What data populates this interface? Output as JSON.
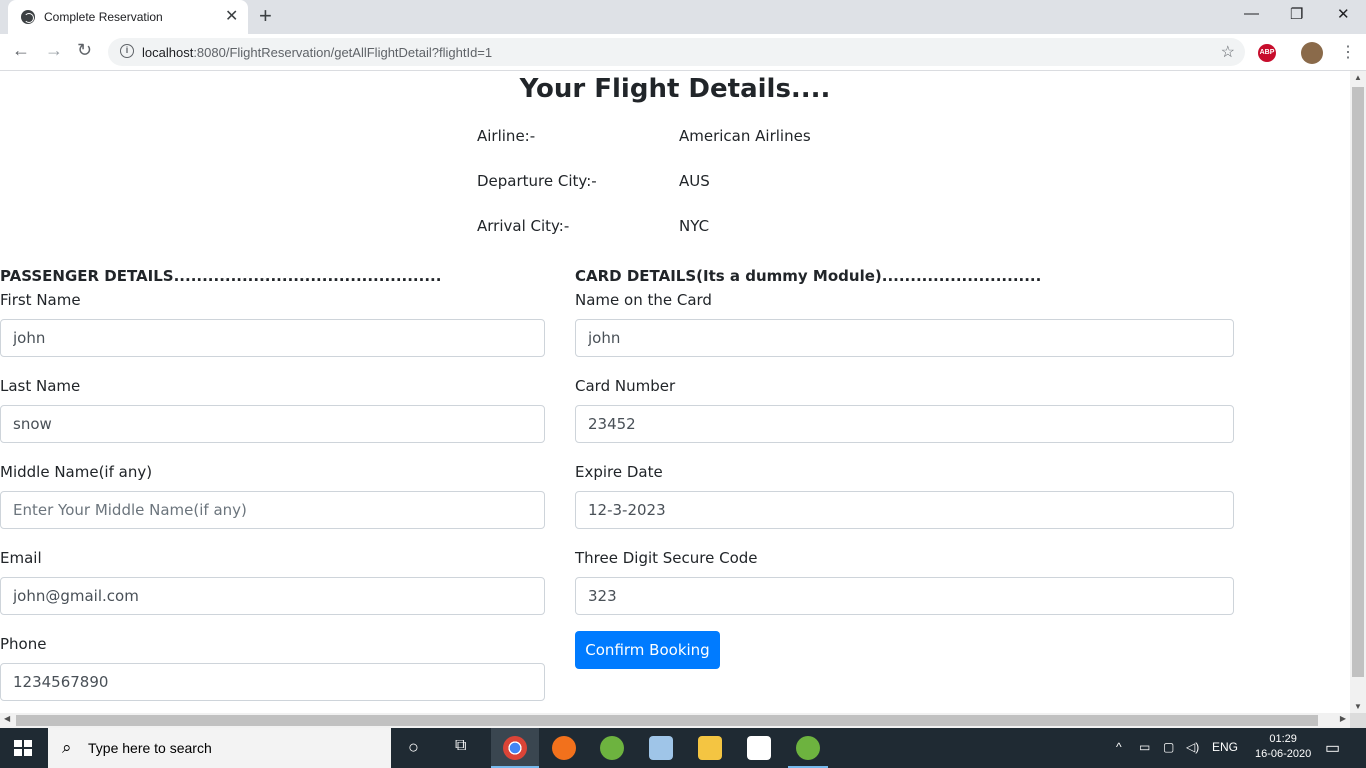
{
  "browser": {
    "tab_title": "Complete Reservation",
    "url_host": "localhost",
    "url_rest": ":8080/FlightReservation/getAllFlightDetail?flightId=1",
    "abp_label": "ABP"
  },
  "page": {
    "heading": "Your Flight Details....",
    "flight": [
      {
        "label": "Airline:-",
        "value": "American Airlines"
      },
      {
        "label": "Departure City:-",
        "value": "AUS"
      },
      {
        "label": "Arrival City:-",
        "value": "NYC"
      }
    ],
    "passenger": {
      "section_title": "PASSENGER DETAILS...............................................",
      "first_name": {
        "label": "First Name",
        "value": "john"
      },
      "last_name": {
        "label": "Last Name",
        "value": "snow"
      },
      "middle_name": {
        "label": "Middle Name(if any)",
        "value": "",
        "placeholder": "Enter Your Middle Name(if any)"
      },
      "email": {
        "label": "Email",
        "value": "john@gmail.com"
      },
      "phone": {
        "label": "Phone",
        "value": "1234567890"
      }
    },
    "card": {
      "section_title": "CARD DETAILS(Its a dummy Module)............................",
      "name_on_card": {
        "label": "Name on the Card",
        "value": "john"
      },
      "card_number": {
        "label": "Card Number",
        "value": "23452"
      },
      "expire_date": {
        "label": "Expire Date",
        "value": "12-3-2023"
      },
      "secure_code": {
        "label": "Three Digit Secure Code",
        "value": "323"
      }
    },
    "confirm_button": "Confirm Booking"
  },
  "taskbar": {
    "search_text": "Type here to search",
    "lang": "ENG",
    "time": "01:29",
    "date": "16-06-2020"
  },
  "colors": {
    "primary_button": "#007bff",
    "taskbar": "#1f2a33"
  }
}
